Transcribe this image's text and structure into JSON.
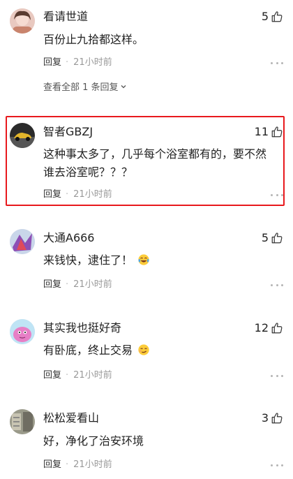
{
  "comments": [
    {
      "username": "看请世道",
      "likes": "5",
      "content": "百份止九拾都这样。",
      "reply": "回复",
      "dot": "·",
      "time": "21小时前",
      "view_all": "查看全部 1 条回复"
    },
    {
      "username": "智者GBZJ",
      "likes": "11",
      "content": "这种事太多了，几乎每个浴室都有的，要不然谁去浴室呢？？？",
      "reply": "回复",
      "dot": "·",
      "time": "21小时前"
    },
    {
      "username": "大通A666",
      "likes": "5",
      "content": "来钱快，逮住了！",
      "reply": "回复",
      "dot": "·",
      "time": "21小时前"
    },
    {
      "username": "其实我也挺好奇",
      "likes": "12",
      "content": "有卧底，终止交易",
      "reply": "回复",
      "dot": "·",
      "time": "21小时前"
    },
    {
      "username": "松松爱看山",
      "likes": "3",
      "content": "好，净化了治安环境",
      "reply": "回复",
      "dot": "·",
      "time": "21小时前"
    }
  ],
  "icons": {
    "like": "thumbs-up-icon",
    "more": "more-dots-icon",
    "expand": "chevron-down-icon",
    "emoji_laugh": "laughing-tears-emoji",
    "emoji_smirk": "smirk-emoji"
  },
  "colors": {
    "highlight_border": "#e8191d",
    "meta_gray": "#999999",
    "text": "#222222"
  }
}
